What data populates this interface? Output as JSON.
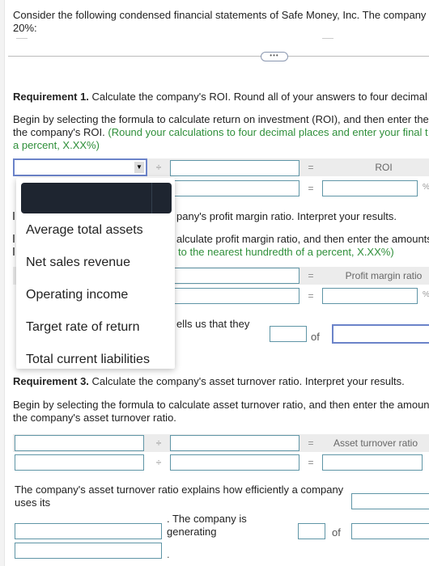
{
  "intro": {
    "line1": "Consider the following condensed financial statements of Safe Money, Inc. The company",
    "line2": "20%:",
    "more_button": "•••"
  },
  "req1": {
    "title_bold": "Requirement 1.",
    "title_rest": " Calculate the company's ROI. Round all of your answers to four decimal",
    "instr_line1": "Begin by selecting the formula to calculate return on investment (ROI), and then enter the",
    "instr_line2_plain": "the company's ROI. ",
    "instr_line2_green": "(Round your calculations to four decimal places and enter your final t",
    "instr_line3_green": "a percent, X.XX%)",
    "operator": "÷",
    "equals": "=",
    "result_label": "ROI",
    "select_value": "",
    "dropdown_icon": "triangle-down",
    "percent_sign": "%"
  },
  "dropdown": {
    "options": [
      "",
      "Average total assets",
      "Net sales revenue",
      "Operating income",
      "Target rate of return",
      "Total current liabilities"
    ]
  },
  "req2": {
    "title_visible": "pany's profit margin ratio. Interpret your results.",
    "instr_line1_visible": "alculate profit margin ratio, and then enter the amounts",
    "instr_line2_green_visible": "to the nearest hundredth of a percent, X.XX%)",
    "equals": "=",
    "result_label": "Profit margin ratio",
    "percent_sign": "%",
    "interpret_visible": "ells us that they",
    "of_label": "of"
  },
  "req3": {
    "title_bold_visible": "Requirement 3.",
    "title_rest": " Calculate the company's asset turnover ratio. Interpret your results.",
    "instr_line1": "Begin by selecting the formula to calculate asset turnover ratio, and then enter the amoun",
    "instr_line2": "the company's asset turnover ratio.",
    "operator": "÷",
    "equals": "=",
    "result_label": "Asset turnover ratio",
    "interpret_line1": "The company's asset turnover ratio explains how efficiently a company",
    "interpret_line2": "uses its",
    "interpret_line3": ". The company is",
    "interpret_line4": "generating",
    "of_label": "of",
    "period": "."
  }
}
